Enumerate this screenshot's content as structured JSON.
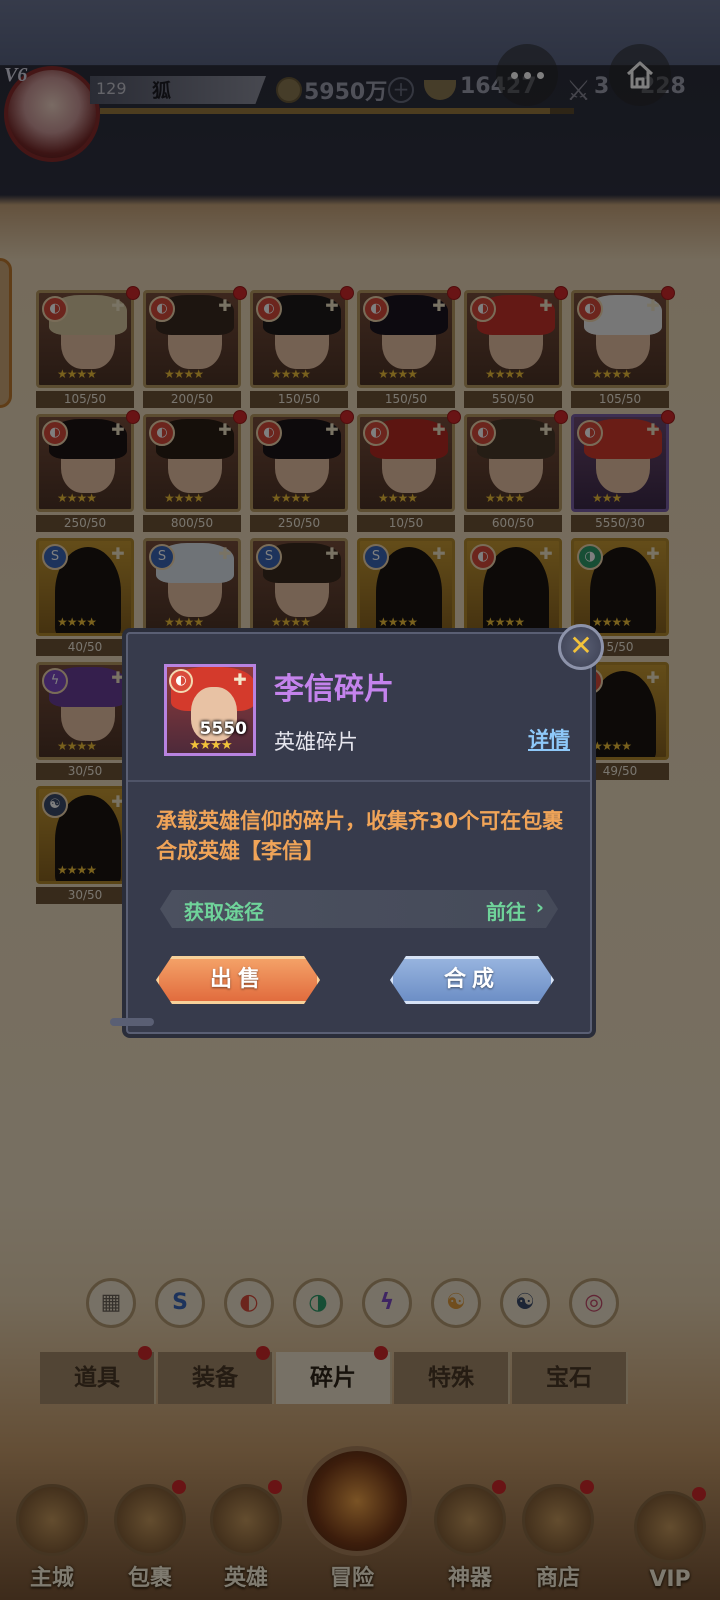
{
  "header": {
    "vip_level": "V6",
    "player_level": "129",
    "player_name": "狐",
    "gold": "5950万",
    "gold_plus": "+",
    "ingot": "16427",
    "power": "3",
    "power_tail": "228",
    "exp_fraction": 0.95
  },
  "fragments": [
    {
      "count": "105/50",
      "elem": "fire",
      "elem_glyph": "◐",
      "kind": "hero",
      "hair": "#d8c8a0",
      "stars": "★★★★",
      "dot": true
    },
    {
      "count": "200/50",
      "elem": "fire",
      "elem_glyph": "◐",
      "kind": "hero",
      "hair": "#3b2a20",
      "stars": "★★★★",
      "dot": true
    },
    {
      "count": "150/50",
      "elem": "fire",
      "elem_glyph": "◐",
      "kind": "hero",
      "hair": "#1e1a1a",
      "stars": "★★★★",
      "dot": true
    },
    {
      "count": "150/50",
      "elem": "fire",
      "elem_glyph": "◐",
      "kind": "hero",
      "hair": "#1a1420",
      "stars": "★★★★",
      "dot": true
    },
    {
      "count": "550/50",
      "elem": "fire",
      "elem_glyph": "◐",
      "kind": "hero",
      "hair": "#c8322a",
      "stars": "★★★★",
      "dot": true
    },
    {
      "count": "105/50",
      "elem": "fire",
      "elem_glyph": "◐",
      "kind": "hero",
      "hair": "#eeeeee",
      "stars": "★★★★",
      "dot": true
    },
    {
      "count": "250/50",
      "elem": "fire",
      "elem_glyph": "◐",
      "kind": "hero",
      "hair": "#1d1414",
      "stars": "★★★★",
      "dot": true
    },
    {
      "count": "800/50",
      "elem": "fire",
      "elem_glyph": "◐",
      "kind": "hero",
      "hair": "#2a1e14",
      "stars": "★★★★",
      "dot": true
    },
    {
      "count": "250/50",
      "elem": "fire",
      "elem_glyph": "◐",
      "kind": "hero",
      "hair": "#1a1418",
      "stars": "★★★★",
      "dot": true
    },
    {
      "count": "10/50",
      "elem": "fire",
      "elem_glyph": "◐",
      "kind": "hero",
      "hair": "#b82a22",
      "stars": "★★★★",
      "dot": true
    },
    {
      "count": "600/50",
      "elem": "fire",
      "elem_glyph": "◐",
      "kind": "hero",
      "hair": "#4a3a2a",
      "stars": "★★★★",
      "dot": true
    },
    {
      "count": "5550/30",
      "elem": "fire",
      "elem_glyph": "◐",
      "kind": "rare",
      "hair": "#d43a2c",
      "stars": "★★★",
      "dot": true
    },
    {
      "count": "40/50",
      "elem": "water",
      "elem_glyph": "S",
      "kind": "shadow",
      "hair": "",
      "stars": "★★★★",
      "dot": false
    },
    {
      "count": "",
      "elem": "water",
      "elem_glyph": "S",
      "kind": "hero",
      "hair": "#dfe6ee",
      "stars": "★★★★",
      "dot": false
    },
    {
      "count": "",
      "elem": "water",
      "elem_glyph": "S",
      "kind": "hero",
      "hair": "#3a2a1e",
      "stars": "★★★★",
      "dot": false
    },
    {
      "count": "",
      "elem": "water",
      "elem_glyph": "S",
      "kind": "shadow",
      "hair": "",
      "stars": "★★★★",
      "dot": false
    },
    {
      "count": "",
      "elem": "fire",
      "elem_glyph": "◐",
      "kind": "shadow",
      "hair": "",
      "stars": "★★★★",
      "dot": false
    },
    {
      "count": "5/50",
      "elem": "wind",
      "elem_glyph": "◑",
      "kind": "shadow",
      "hair": "",
      "stars": "★★★★",
      "dot": false
    },
    {
      "count": "30/50",
      "elem": "thunder",
      "elem_glyph": "ϟ",
      "kind": "hero",
      "hair": "#6a3e9a",
      "stars": "★★★★",
      "dot": false
    },
    {
      "count": "",
      "elem": "fire",
      "elem_glyph": "◐",
      "kind": "none",
      "hair": "",
      "stars": "",
      "dot": false
    },
    {
      "count": "",
      "elem": "fire",
      "elem_glyph": "◐",
      "kind": "none",
      "hair": "",
      "stars": "",
      "dot": false
    },
    {
      "count": "",
      "elem": "fire",
      "elem_glyph": "◐",
      "kind": "none",
      "hair": "",
      "stars": "",
      "dot": false
    },
    {
      "count": "",
      "elem": "fire",
      "elem_glyph": "◐",
      "kind": "none",
      "hair": "",
      "stars": "",
      "dot": false
    },
    {
      "count": "49/50",
      "elem": "fire",
      "elem_glyph": "◐",
      "kind": "shadow",
      "hair": "",
      "stars": "★★★★",
      "dot": false
    },
    {
      "count": "30/50",
      "elem": "dark",
      "elem_glyph": "☯",
      "kind": "shadow",
      "hair": "",
      "stars": "★★★★",
      "dot": false
    }
  ],
  "filters": [
    {
      "name": "all",
      "glyph": "▦",
      "color": "#6b6358"
    },
    {
      "name": "water",
      "glyph": "S",
      "color": "#3a67b8"
    },
    {
      "name": "fire",
      "glyph": "◐",
      "color": "#d94a3a"
    },
    {
      "name": "wind",
      "glyph": "◑",
      "color": "#2e9c6a"
    },
    {
      "name": "thunder",
      "glyph": "ϟ",
      "color": "#7e4bc7"
    },
    {
      "name": "light",
      "glyph": "☯",
      "color": "#e09a3a"
    },
    {
      "name": "dark",
      "glyph": "☯",
      "color": "#3b4a6a"
    },
    {
      "name": "spiral",
      "glyph": "◎",
      "color": "#c24a6a"
    }
  ],
  "tabs": [
    {
      "label": "道具",
      "active": false,
      "dot": true
    },
    {
      "label": "装备",
      "active": false,
      "dot": true
    },
    {
      "label": "碎片",
      "active": true,
      "dot": true
    },
    {
      "label": "特殊",
      "active": false,
      "dot": false
    },
    {
      "label": "宝石",
      "active": false,
      "dot": false
    }
  ],
  "nav": [
    {
      "label": "主城",
      "dot": false
    },
    {
      "label": "包裹",
      "dot": true
    },
    {
      "label": "英雄",
      "dot": true
    },
    {
      "label": "冒险",
      "dot": false
    },
    {
      "label": "神器",
      "dot": true
    },
    {
      "label": "商店",
      "dot": true
    },
    {
      "label": "VIP",
      "dot": true
    }
  ],
  "dialog": {
    "title": "李信碎片",
    "type_label": "英雄碎片",
    "detail_link": "详情",
    "item_count": "5550",
    "item_stars": "★★★★",
    "description": "承载英雄信仰的碎片，收集齐30个可在包裹合成英雄【李信】",
    "source_label": "获取途径",
    "source_go": "前往",
    "source_chevron": "›",
    "sell_label": "出售",
    "compose_label": "合成",
    "close_glyph": "✕"
  },
  "colors": {
    "title_purple": "#c483ec",
    "desc_orange": "#f0a458",
    "source_green": "#6fd39a",
    "detail_blue": "#8ec8f8"
  }
}
